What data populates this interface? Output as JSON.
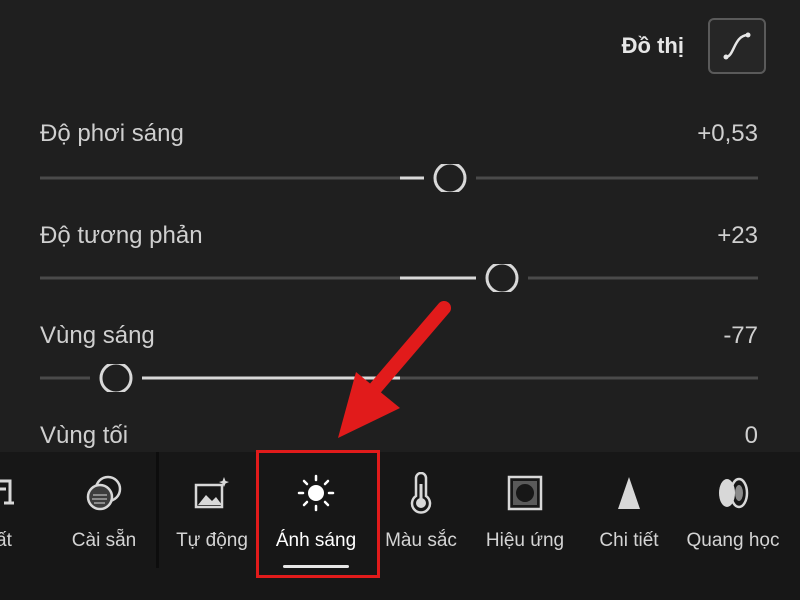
{
  "header": {
    "graph_label": "Đồ thị",
    "curve_icon": "curve-icon"
  },
  "sliders": [
    {
      "label": "Độ phơi sáng",
      "value": "+0,53",
      "level": 0.59
    },
    {
      "label": "Độ tương phản",
      "value": "+23",
      "level": 0.67
    },
    {
      "label": "Vùng sáng",
      "value": "-77",
      "level": 0.11
    },
    {
      "label": "Vùng tối",
      "value": "0"
    }
  ],
  "toolbar": {
    "items": [
      {
        "label": "ất",
        "icon": "crop-rotate-icon"
      },
      {
        "label": "Cài sẵn",
        "icon": "presets-icon"
      },
      {
        "label": "Tự động",
        "icon": "auto-icon"
      },
      {
        "label": "Ánh sáng",
        "icon": "sun-icon",
        "active": true
      },
      {
        "label": "Màu sắc",
        "icon": "thermometer-icon"
      },
      {
        "label": "Hiệu ứng",
        "icon": "vignette-icon"
      },
      {
        "label": "Chi tiết",
        "icon": "triangle-icon"
      },
      {
        "label": "Quang học",
        "icon": "lens-icon"
      }
    ]
  },
  "colors": {
    "highlight": "#e11b1b",
    "background": "#1f1f1f",
    "toolbar": "#171717"
  }
}
